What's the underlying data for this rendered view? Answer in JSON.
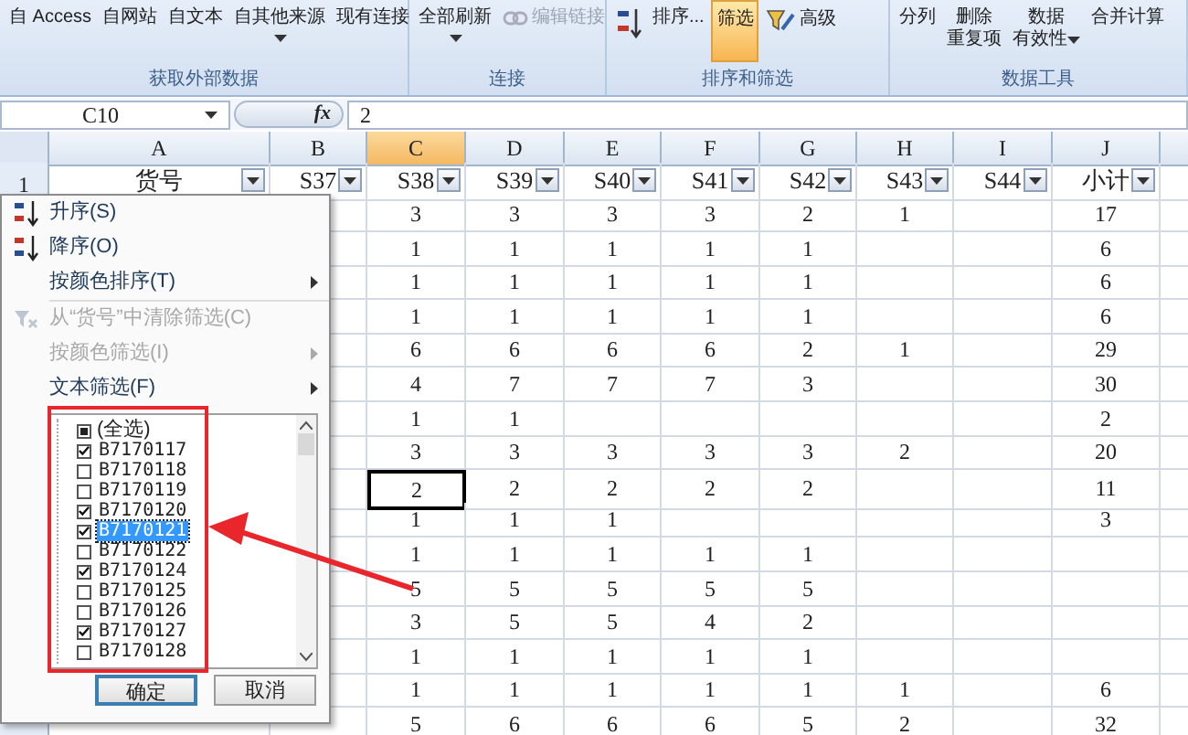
{
  "ribbon": {
    "groups": [
      {
        "label": "获取外部数据",
        "items": [
          {
            "lines": [
              "自 Access"
            ],
            "kind": "text",
            "disabled": false,
            "on": false
          },
          {
            "lines": [
              "自网站"
            ],
            "kind": "text",
            "disabled": false,
            "on": false
          },
          {
            "lines": [
              "自文本"
            ],
            "kind": "text",
            "disabled": false,
            "on": false
          },
          {
            "lines": [
              "自其他来源"
            ],
            "kind": "dropdown",
            "disabled": false,
            "on": false
          },
          {
            "lines": [
              "现有连接"
            ],
            "kind": "text",
            "disabled": false,
            "on": false
          }
        ]
      },
      {
        "label": "连接",
        "items": [
          {
            "lines": [
              "全部刷新"
            ],
            "kind": "dropdown",
            "disabled": false,
            "on": false
          },
          {
            "lines": [
              "编辑链接"
            ],
            "kind": "link",
            "disabled": true,
            "on": false
          }
        ]
      },
      {
        "label": "排序和筛选",
        "items": [
          {
            "kind": "sort",
            "disabled": false,
            "on": false
          },
          {
            "lines": [
              "排序..."
            ],
            "kind": "text",
            "disabled": false,
            "on": false
          },
          {
            "lines": [
              "筛选"
            ],
            "kind": "text",
            "disabled": false,
            "on": true
          },
          {
            "lines": [
              "高级"
            ],
            "kind": "advanced",
            "disabled": false,
            "on": false
          }
        ]
      },
      {
        "label": "数据工具",
        "items": [
          {
            "lines": [
              "分列"
            ],
            "kind": "text",
            "disabled": false,
            "on": false
          },
          {
            "lines": [
              "删除",
              "重复项"
            ],
            "kind": "text",
            "disabled": false,
            "on": false
          },
          {
            "lines": [
              "数据",
              "有效性"
            ],
            "kind": "dropdown",
            "disabled": false,
            "on": false
          },
          {
            "lines": [
              "合并计算"
            ],
            "kind": "text",
            "disabled": false,
            "on": false
          }
        ]
      }
    ]
  },
  "formula_bar": {
    "name_box": "C10",
    "fx": "fx",
    "value": "2"
  },
  "sheet": {
    "columns": [
      {
        "label": "A",
        "selected": false
      },
      {
        "label": "B",
        "selected": false
      },
      {
        "label": "C",
        "selected": true
      },
      {
        "label": "D",
        "selected": false
      },
      {
        "label": "E",
        "selected": false
      },
      {
        "label": "F",
        "selected": false
      },
      {
        "label": "G",
        "selected": false
      },
      {
        "label": "H",
        "selected": false
      },
      {
        "label": "I",
        "selected": false
      },
      {
        "label": "J",
        "selected": false
      }
    ],
    "header_row": {
      "number": "1",
      "cells": [
        "货号",
        "S37",
        "S38",
        "S39",
        "S40",
        "S41",
        "S42",
        "S43",
        "S44",
        "小计"
      ]
    },
    "rows": [
      {
        "selected": false,
        "cells": [
          "",
          "",
          "3",
          "3",
          "3",
          "3",
          "2",
          "1",
          "",
          "17"
        ]
      },
      {
        "selected": false,
        "cells": [
          "",
          "",
          "1",
          "1",
          "1",
          "1",
          "1",
          "",
          "",
          "6"
        ]
      },
      {
        "selected": false,
        "cells": [
          "",
          "",
          "1",
          "1",
          "1",
          "1",
          "1",
          "",
          "",
          "6"
        ]
      },
      {
        "selected": false,
        "cells": [
          "",
          "",
          "1",
          "1",
          "1",
          "1",
          "1",
          "",
          "",
          "6"
        ]
      },
      {
        "selected": false,
        "cells": [
          "",
          "",
          "6",
          "6",
          "6",
          "6",
          "2",
          "1",
          "",
          "29"
        ]
      },
      {
        "selected": false,
        "cells": [
          "",
          "",
          "4",
          "7",
          "7",
          "7",
          "3",
          "",
          "",
          "30"
        ]
      },
      {
        "selected": false,
        "cells": [
          "",
          "",
          "1",
          "1",
          "",
          "",
          "",
          "",
          "",
          "2"
        ]
      },
      {
        "selected": false,
        "cells": [
          "",
          "",
          "3",
          "3",
          "3",
          "3",
          "3",
          "2",
          "",
          "20"
        ]
      },
      {
        "selected": true,
        "cells": [
          "",
          "",
          "2",
          "2",
          "2",
          "2",
          "2",
          "",
          "",
          "11"
        ]
      },
      {
        "selected": false,
        "cells": [
          "",
          "",
          "1",
          "1",
          "1",
          "",
          "",
          "",
          "",
          "3"
        ]
      },
      {
        "selected": false,
        "cells": [
          "",
          "",
          "1",
          "1",
          "1",
          "1",
          "1",
          "",
          "",
          ""
        ]
      },
      {
        "selected": false,
        "cells": [
          "",
          "",
          "5",
          "5",
          "5",
          "5",
          "5",
          "",
          "",
          ""
        ]
      },
      {
        "selected": false,
        "cells": [
          "",
          "",
          "3",
          "5",
          "5",
          "4",
          "2",
          "",
          "",
          ""
        ]
      },
      {
        "selected": false,
        "cells": [
          "",
          "",
          "1",
          "1",
          "1",
          "1",
          "1",
          "",
          "",
          ""
        ]
      },
      {
        "selected": false,
        "cells": [
          "",
          "",
          "1",
          "1",
          "1",
          "1",
          "1",
          "1",
          "",
          "6"
        ]
      },
      {
        "selected": false,
        "cells": [
          "",
          "",
          "5",
          "6",
          "6",
          "6",
          "5",
          "2",
          "",
          "32"
        ]
      }
    ]
  },
  "filter_menu": {
    "items": [
      {
        "label": "升序(S)",
        "kind": "sort_asc",
        "disabled": false,
        "submenu": false
      },
      {
        "label": "降序(O)",
        "kind": "sort_desc",
        "disabled": false,
        "submenu": false
      },
      {
        "label": "按颜色排序(T)",
        "kind": "plain",
        "disabled": false,
        "submenu": true
      },
      {
        "label": "从“货号”中清除筛选(C)",
        "kind": "clear",
        "disabled": true,
        "submenu": false
      },
      {
        "label": "按颜色筛选(I)",
        "kind": "plain",
        "disabled": true,
        "submenu": true
      },
      {
        "label": "文本筛选(F)",
        "kind": "plain",
        "disabled": false,
        "submenu": true
      }
    ],
    "select_all": {
      "label": "(全选)",
      "mixed": true
    },
    "values": [
      {
        "label": "B7170117",
        "checked": true,
        "selected": false
      },
      {
        "label": "B7170118",
        "checked": false,
        "selected": false
      },
      {
        "label": "B7170119",
        "checked": false,
        "selected": false
      },
      {
        "label": "B7170120",
        "checked": true,
        "selected": false
      },
      {
        "label": "B7170121",
        "checked": true,
        "selected": true
      },
      {
        "label": "B7170122",
        "checked": false,
        "selected": false
      },
      {
        "label": "B7170124",
        "checked": true,
        "selected": false
      },
      {
        "label": "B7170125",
        "checked": false,
        "selected": false
      },
      {
        "label": "B7170126",
        "checked": false,
        "selected": false
      },
      {
        "label": "B7170127",
        "checked": true,
        "selected": false
      },
      {
        "label": "B7170128",
        "checked": false,
        "selected": false
      }
    ],
    "buttons": [
      {
        "label": "确定",
        "focused": true
      },
      {
        "label": "取消",
        "focused": false
      }
    ]
  }
}
